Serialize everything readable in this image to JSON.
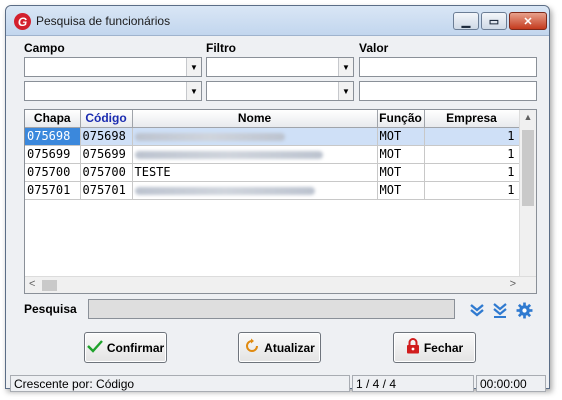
{
  "window": {
    "title": "Pesquisa de funcionários",
    "app_icon_letter": "G",
    "controls": {
      "minimize": "▁",
      "maximize": "▭",
      "close": "✕"
    }
  },
  "filters": {
    "labels": {
      "campo": "Campo",
      "filtro": "Filtro",
      "valor": "Valor"
    },
    "rows": [
      {
        "campo": "",
        "filtro": "",
        "valor": ""
      },
      {
        "campo": "",
        "filtro": "",
        "valor": ""
      }
    ]
  },
  "grid": {
    "columns": [
      "Chapa",
      "Código",
      "Nome",
      "Função",
      "Empresa"
    ],
    "sorted_column": "Código",
    "rows": [
      {
        "chapa": "075698",
        "codigo": "075698",
        "nome": "",
        "funcao": "MOT",
        "empresa": "1",
        "selected": true
      },
      {
        "chapa": "075699",
        "codigo": "075699",
        "nome": "",
        "funcao": "MOT",
        "empresa": "1",
        "selected": false
      },
      {
        "chapa": "075700",
        "codigo": "075700",
        "nome": "TESTE",
        "funcao": "MOT",
        "empresa": "1",
        "selected": false
      },
      {
        "chapa": "075701",
        "codigo": "075701",
        "nome": "",
        "funcao": "MOT",
        "empresa": "1",
        "selected": false
      }
    ]
  },
  "search": {
    "label": "Pesquisa",
    "value": ""
  },
  "icons": [
    "double-chevron-down-icon",
    "chevron-to-bottom-icon",
    "gear-icon"
  ],
  "buttons": {
    "confirmar": "Confirmar",
    "atualizar": "Atualizar",
    "fechar": "Fechar"
  },
  "status": {
    "sort": "Crescente por: Código",
    "position": "1 / 4 / 4",
    "time": "00:00:00"
  },
  "colors": {
    "selection": "#3b88dc",
    "accent": "#2f7ad0",
    "close": "#c43a1e"
  }
}
